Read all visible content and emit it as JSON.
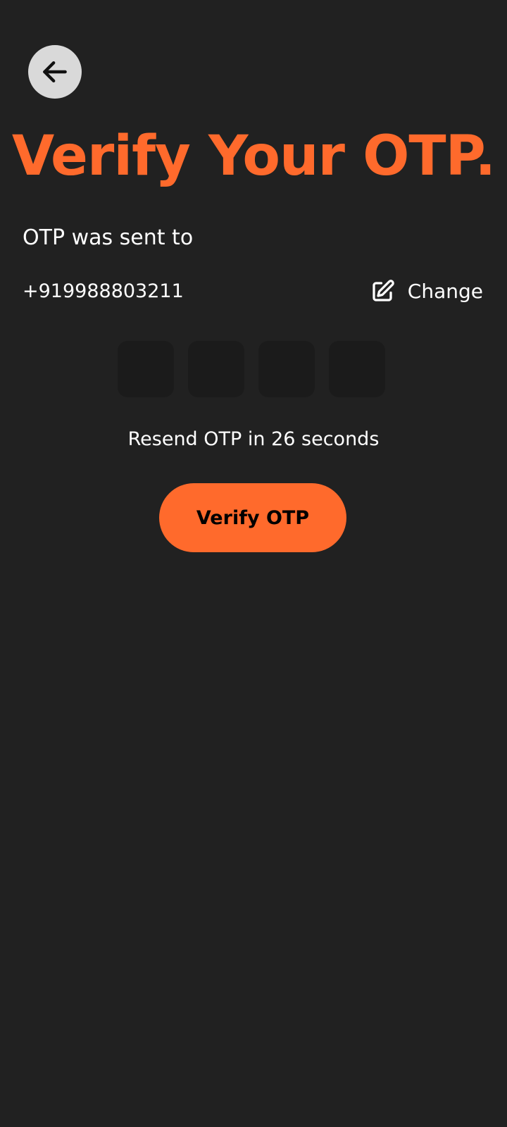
{
  "header": {
    "back_icon": "arrow-left-icon",
    "title": "Verify Your OTP."
  },
  "recipient": {
    "label": "OTP was sent to",
    "phone": "+919988803211",
    "change_icon": "edit-icon",
    "change_label": "Change"
  },
  "otp": {
    "length": 4,
    "digits": [
      "",
      "",
      "",
      ""
    ]
  },
  "resend": {
    "text": "Resend OTP in 26 seconds"
  },
  "actions": {
    "verify_label": "Verify OTP"
  },
  "colors": {
    "background": "#212121",
    "accent": "#ff6a2c",
    "otp_box": "#1b1b1b",
    "back_button": "#d9d9d9"
  }
}
